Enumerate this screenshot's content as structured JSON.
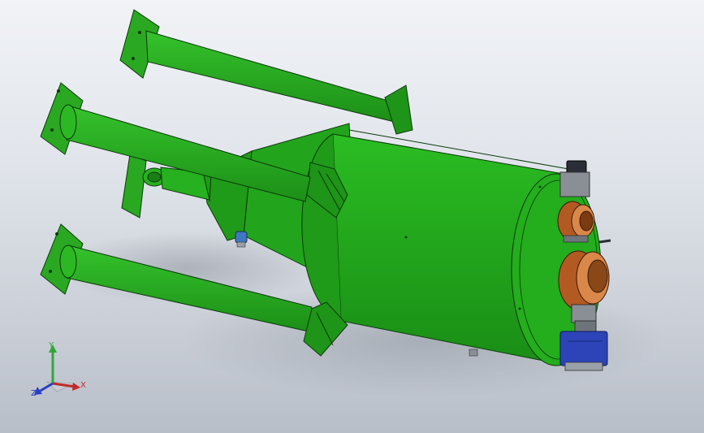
{
  "viewport": {
    "background_top": "#f1f3f6",
    "background_bottom": "#b8bec8"
  },
  "model": {
    "body_color": "#22a51c",
    "body_dark": "#157a12",
    "outline_color": "#0b3a0a",
    "flange_color": "#c8642a",
    "actuator_color": "#2c44b8",
    "valve_gray": "#8a8f96"
  },
  "triad": {
    "x_label": "X",
    "y_label": "Y",
    "z_label": "Z",
    "x_color": "#c22a2a",
    "y_color": "#2fa83a",
    "z_color": "#2a3fc2"
  }
}
